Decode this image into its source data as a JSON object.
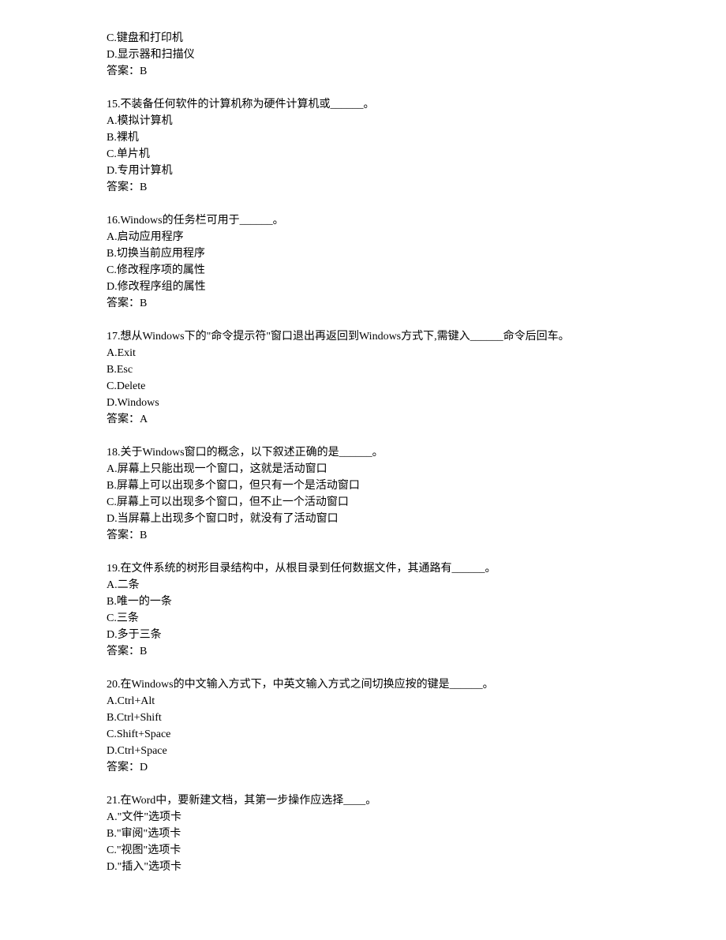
{
  "prefix": {
    "lines": [
      "C.键盘和打印机",
      "D.显示器和扫描仪",
      "答案：B"
    ]
  },
  "questions": [
    {
      "stem": "15.不装备任何软件的计算机称为硬件计算机或______。",
      "options": [
        "A.模拟计算机",
        "B.裸机",
        "C.单片机",
        "D.专用计算机"
      ],
      "answer": "答案：B"
    },
    {
      "stem": "16.Windows的任务栏可用于______。",
      "options": [
        "A.启动应用程序",
        "B.切换当前应用程序",
        "C.修改程序项的属性",
        "D.修改程序组的属性"
      ],
      "answer": "答案：B"
    },
    {
      "stem": "17.想从Windows下的\"命令提示符\"窗口退出再返回到Windows方式下,需键入______命令后回车。",
      "options": [
        "A.Exit",
        "B.Esc",
        "C.Delete",
        "D.Windows"
      ],
      "answer": "答案：A"
    },
    {
      "stem": "18.关于Windows窗口的概念，以下叙述正确的是______。",
      "options": [
        "A.屏幕上只能出现一个窗口，这就是活动窗口",
        "B.屏幕上可以出现多个窗口，但只有一个是活动窗口",
        "C.屏幕上可以出现多个窗口，但不止一个活动窗口",
        "D.当屏幕上出现多个窗口时，就没有了活动窗口"
      ],
      "answer": "答案：B"
    },
    {
      "stem": "19.在文件系统的树形目录结构中，从根目录到任何数据文件，其通路有______。",
      "options": [
        "A.二条",
        "B.唯一的一条",
        "C.三条",
        "D.多于三条"
      ],
      "answer": "答案：B"
    },
    {
      "stem": "20.在Windows的中文输入方式下，中英文输入方式之间切换应按的键是______。",
      "options": [
        "A.Ctrl+Alt",
        "B.Ctrl+Shift",
        "C.Shift+Space",
        "D.Ctrl+Space"
      ],
      "answer": "答案：D"
    },
    {
      "stem": "21.在Word中，要新建文档，其第一步操作应选择____。",
      "options": [
        "A.\"文件\"选项卡",
        "B.\"审阅\"选项卡",
        "C.\"视图\"选项卡",
        "D.\"插入\"选项卡"
      ],
      "answer": ""
    }
  ]
}
